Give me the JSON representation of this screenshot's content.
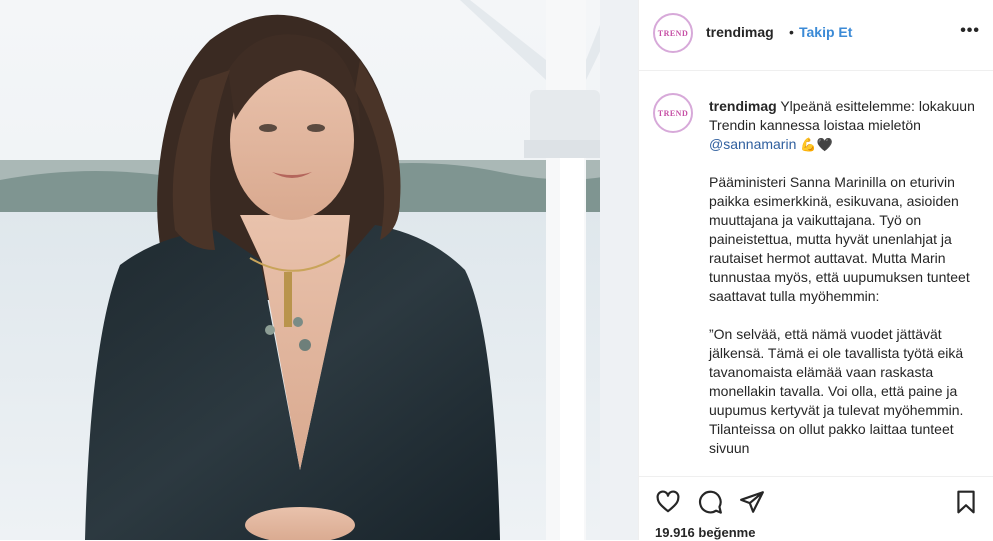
{
  "post": {
    "username": "trendimag",
    "separator": "•",
    "follow_label": "Takip Et",
    "more_icon": "more-horizontal-icon",
    "avatar_text": "TREND"
  },
  "caption": {
    "username": "trendimag",
    "intro": " Ylpeänä esittelemme: lokakuun Trendin kannessa loistaa mieletön ",
    "mention": "@sannamarin",
    "emojis": "💪🖤",
    "paragraph2": "Pääministeri Sanna Marinilla on eturivin paikka esimerkkinä, esikuvana, asioiden muuttajana ja vaikuttajana. Työ on paineistettua, mutta hyvät unenlahjat ja rautaiset hermot auttavat. Mutta Marin tunnustaa myös, että uupumuksen tunteet saattavat tulla myöhemmin:",
    "paragraph3": "”On selvää, että nämä vuodet jättävät jälkensä. Tämä ei ole tavallista työtä eikä tavanomaista elämää vaan raskasta monellakin tavalla. Voi olla, että paine ja uupumus kertyvät ja tulevat myöhemmin. Tilanteissa on ollut pakko laittaa tunteet sivuun"
  },
  "actions": {
    "like_icon": "heart-icon",
    "comment_icon": "comment-icon",
    "share_icon": "send-icon",
    "save_icon": "bookmark-icon",
    "likes_text": "19.916 beğenme"
  },
  "colors": {
    "follow": "#3b8ad6",
    "mention": "#2f5f9e",
    "text": "#262626",
    "divider": "#efefef"
  }
}
